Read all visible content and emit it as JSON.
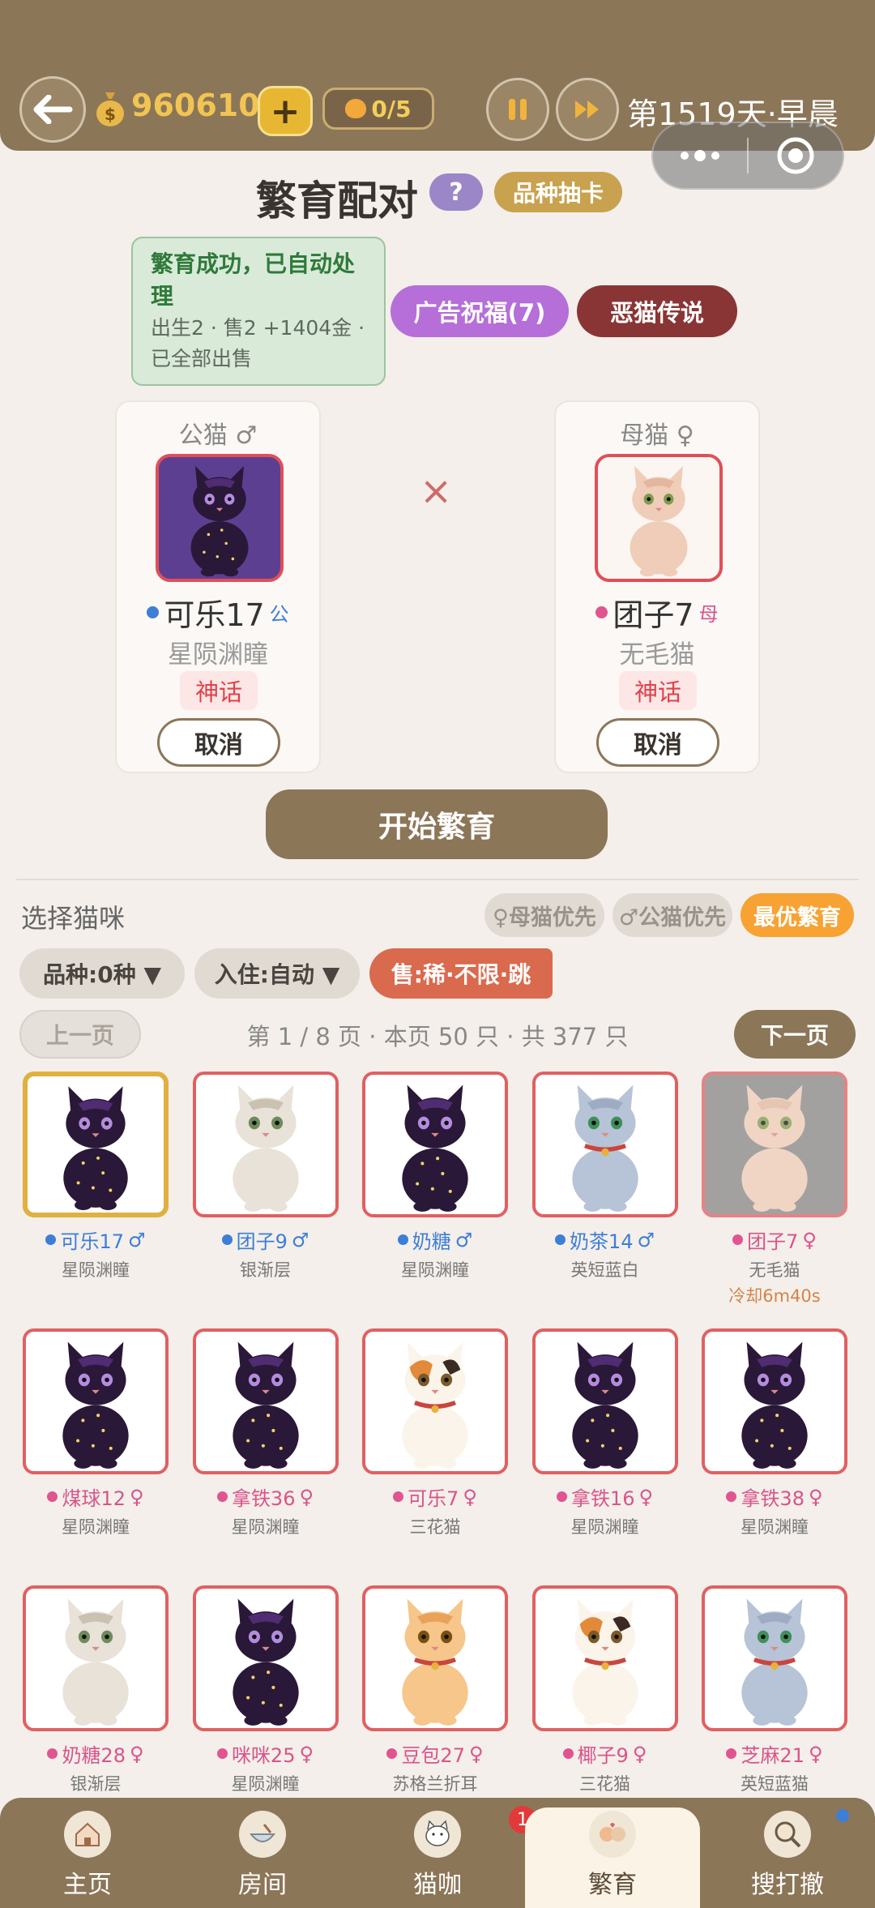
{
  "topbar": {
    "coins": "9606105",
    "plus": "+",
    "cat_count": "0/5",
    "day": "第1519天·早晨",
    "icons": [
      "back-arrow-icon",
      "money-bag-icon",
      "pause-icon",
      "fast-forward-icon",
      "more-dots-icon",
      "target-icon"
    ]
  },
  "header": {
    "title": "繁育配对",
    "help": "?",
    "gacha": "品种抽卡"
  },
  "notice": {
    "title": "繁育成功，已自动处理",
    "body": "出生2 · 售2 +1404金 · 已全部出售"
  },
  "actions": {
    "ad": "广告祝福(7)",
    "evil": "恶猫传说"
  },
  "male": {
    "role": "公猫 ♂",
    "name": "可乐17",
    "gender": "公",
    "breed": "星陨渊瞳",
    "rarity": "神话",
    "cancel": "取消"
  },
  "female": {
    "role": "母猫 ♀",
    "name": "团子7",
    "gender": "母",
    "breed": "无毛猫",
    "rarity": "神话",
    "cancel": "取消"
  },
  "cross": "×",
  "start": "开始繁育",
  "select": {
    "title": "选择猫咪",
    "female_first": "♀母猫优先",
    "male_first": "♂公猫优先",
    "best": "最优繁育",
    "breed_filter": "品种:0种 ▼",
    "house_filter": "入住:自动 ▼",
    "sale_filter": "售:稀·不限·跳",
    "prev": "上一页",
    "page_info": "第 1 / 8 页 · 本页 50 只 · 共 377 只",
    "next": "下一页"
  },
  "cats": [
    {
      "name": "可乐17",
      "g": "♂",
      "sex": "m",
      "breed": "星陨渊瞳",
      "look": "cosmic",
      "selected": true
    },
    {
      "name": "团子9",
      "g": "♂",
      "sex": "m",
      "breed": "银渐层",
      "look": "silver"
    },
    {
      "name": "奶糖",
      "g": "♂",
      "sex": "m",
      "breed": "星陨渊瞳",
      "look": "cosmic"
    },
    {
      "name": "奶茶14",
      "g": "♂",
      "sex": "m",
      "breed": "英短蓝白",
      "look": "blue"
    },
    {
      "name": "团子7",
      "g": "♀",
      "sex": "f",
      "breed": "无毛猫",
      "look": "sphynx",
      "cooldown": "冷却6m40s"
    },
    {
      "name": "煤球12",
      "g": "♀",
      "sex": "f",
      "breed": "星陨渊瞳",
      "look": "cosmic"
    },
    {
      "name": "拿铁36",
      "g": "♀",
      "sex": "f",
      "breed": "星陨渊瞳",
      "look": "cosmic"
    },
    {
      "name": "可乐7",
      "g": "♀",
      "sex": "f",
      "breed": "三花猫",
      "look": "calico"
    },
    {
      "name": "拿铁16",
      "g": "♀",
      "sex": "f",
      "breed": "星陨渊瞳",
      "look": "cosmic"
    },
    {
      "name": "拿铁38",
      "g": "♀",
      "sex": "f",
      "breed": "星陨渊瞳",
      "look": "cosmic"
    },
    {
      "name": "奶糖28",
      "g": "♀",
      "sex": "f",
      "breed": "银渐层",
      "look": "silver"
    },
    {
      "name": "咪咪25",
      "g": "♀",
      "sex": "f",
      "breed": "星陨渊瞳",
      "look": "cosmic"
    },
    {
      "name": "豆包27",
      "g": "♀",
      "sex": "f",
      "breed": "苏格兰折耳",
      "look": "orange"
    },
    {
      "name": "椰子9",
      "g": "♀",
      "sex": "f",
      "breed": "三花猫",
      "look": "calico"
    },
    {
      "name": "芝麻21",
      "g": "♀",
      "sex": "f",
      "breed": "英短蓝猫",
      "look": "blue"
    }
  ],
  "nav": [
    {
      "label": "主页",
      "icon": "house-icon"
    },
    {
      "label": "房间",
      "icon": "bowl-icon"
    },
    {
      "label": "猫咖",
      "icon": "cat-cup-icon",
      "badge": "1"
    },
    {
      "label": "繁育",
      "icon": "cat-pair-icon",
      "active": true
    },
    {
      "label": "搜打撤",
      "icon": "magnifier-cat-icon",
      "dot": true
    }
  ],
  "colors": {
    "brand": "#8c7658",
    "male": "#3d7ed6",
    "female": "#e05590",
    "card_border": "#e06062",
    "selected_border": "#e0b040"
  }
}
